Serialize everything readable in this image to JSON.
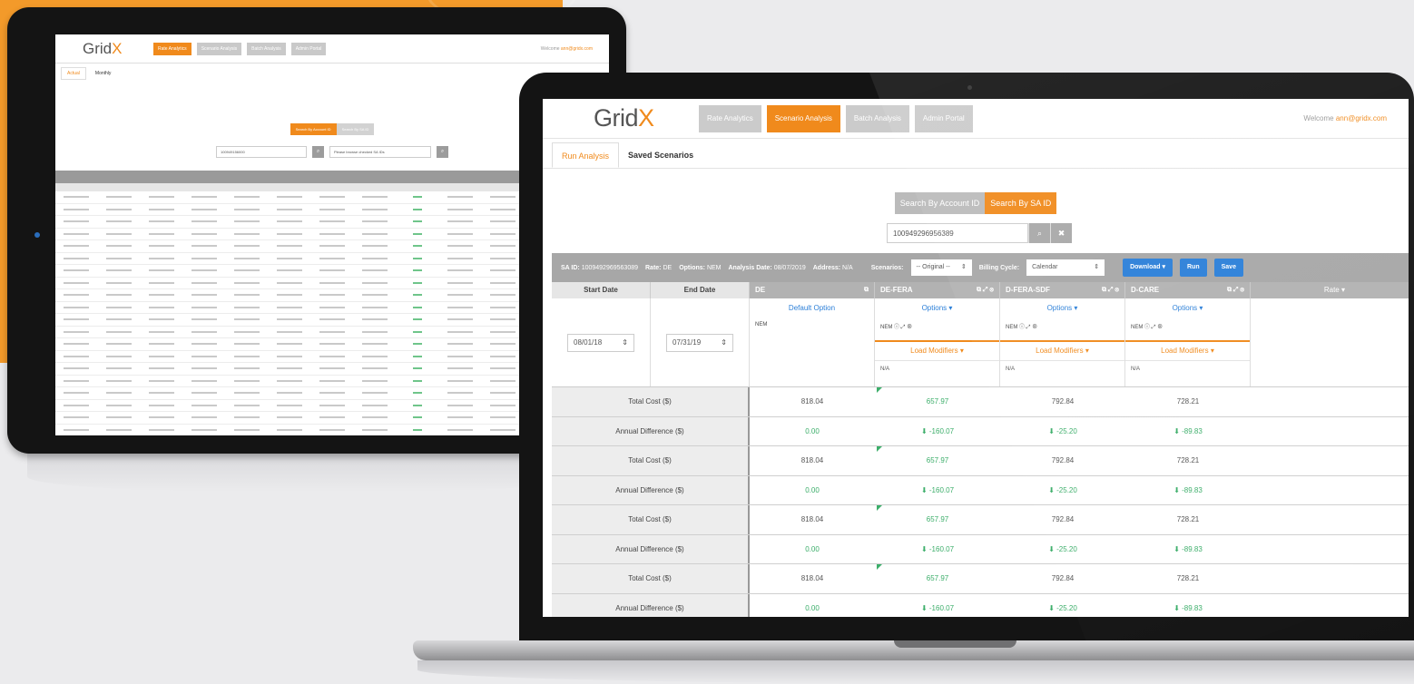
{
  "colors": {
    "accent": "#f08a1c",
    "blue": "#2b7fd8",
    "green": "#3cae6a",
    "orange_bg": "#f39a2a"
  },
  "tablet": {
    "logo": {
      "main": "Grid",
      "x": "X"
    },
    "tabs": [
      "Rate Analytics",
      "Scenario Analysis",
      "Batch Analysis",
      "Admin Portal"
    ],
    "welcome": "Welcome",
    "welcome_user": "ann@gridx.com",
    "subtabs": [
      "Actual",
      "Monthly"
    ],
    "search_by_account": "Search By Account ID",
    "search_by_sa": "Search By SA ID",
    "account_input": "100949156000",
    "browse_text": "Please browse checked SA IDs",
    "go_icon": "search-icon"
  },
  "app": {
    "logo": {
      "main": "Grid",
      "x": "X"
    },
    "tabs": [
      "Rate Analytics",
      "Scenario Analysis",
      "Batch Analysis",
      "Admin Portal"
    ],
    "welcome_label": "Welcome",
    "welcome_email": "ann@gridx.com",
    "subtabs": [
      "Run Analysis",
      "Saved Scenarios"
    ],
    "search_account_btn": "Search By Account ID",
    "search_sa_btn": "Search By SA ID",
    "sa_input": "100949296956389",
    "search_icon": "search-icon",
    "clear_icon": "close-icon",
    "info_bar": {
      "sa_id_label": "SA ID:",
      "sa_id_value": "1009492969563089",
      "rate_label": "Rate:",
      "rate_value": "DE",
      "options_label": "Options:",
      "options_value": "NEM",
      "analysis_date_label": "Analysis Date:",
      "analysis_date_value": "08/07/2019",
      "address_label": "Address:",
      "address_value": "N/A",
      "scenarios_label": "Scenarios:",
      "scenarios_value": "-- Original --",
      "billing_label": "Billing Cycle:",
      "billing_value": "Calendar",
      "download_btn": "Download",
      "run_btn": "Run",
      "save_btn": "Save"
    },
    "columns": {
      "start_date": "Start Date",
      "end_date": "End Date",
      "rates": [
        "DE",
        "DE-FERA",
        "D-FERA-SDF",
        "D-CARE"
      ],
      "rate_add": "Rate"
    },
    "dates": {
      "start": "08/01/18",
      "end": "07/31/19"
    },
    "options": {
      "default_option": "Default Option",
      "options_link": "Options",
      "nem": "NEM",
      "load_modifiers": "Load Modifiers",
      "na": "N/A"
    },
    "rows": [
      {
        "label": "Total Cost ($)",
        "values": [
          "818.04",
          "657.97",
          "792.84",
          "728.21"
        ]
      },
      {
        "label": "Annual Difference ($)",
        "values": [
          "0.00",
          "-160.07",
          "-25.20",
          "-89.83"
        ]
      },
      {
        "label": "Total Cost ($)",
        "values": [
          "818.04",
          "657.97",
          "792.84",
          "728.21"
        ]
      },
      {
        "label": "Annual Difference ($)",
        "values": [
          "0.00",
          "-160.07",
          "-25.20",
          "-89.83"
        ]
      },
      {
        "label": "Total Cost ($)",
        "values": [
          "818.04",
          "657.97",
          "792.84",
          "728.21"
        ]
      },
      {
        "label": "Annual Difference ($)",
        "values": [
          "0.00",
          "-160.07",
          "-25.20",
          "-89.83"
        ]
      },
      {
        "label": "Total Cost ($)",
        "values": [
          "818.04",
          "657.97",
          "792.84",
          "728.21"
        ]
      },
      {
        "label": "Annual Difference ($)",
        "values": [
          "0.00",
          "-160.07",
          "-25.20",
          "-89.83"
        ]
      }
    ]
  }
}
